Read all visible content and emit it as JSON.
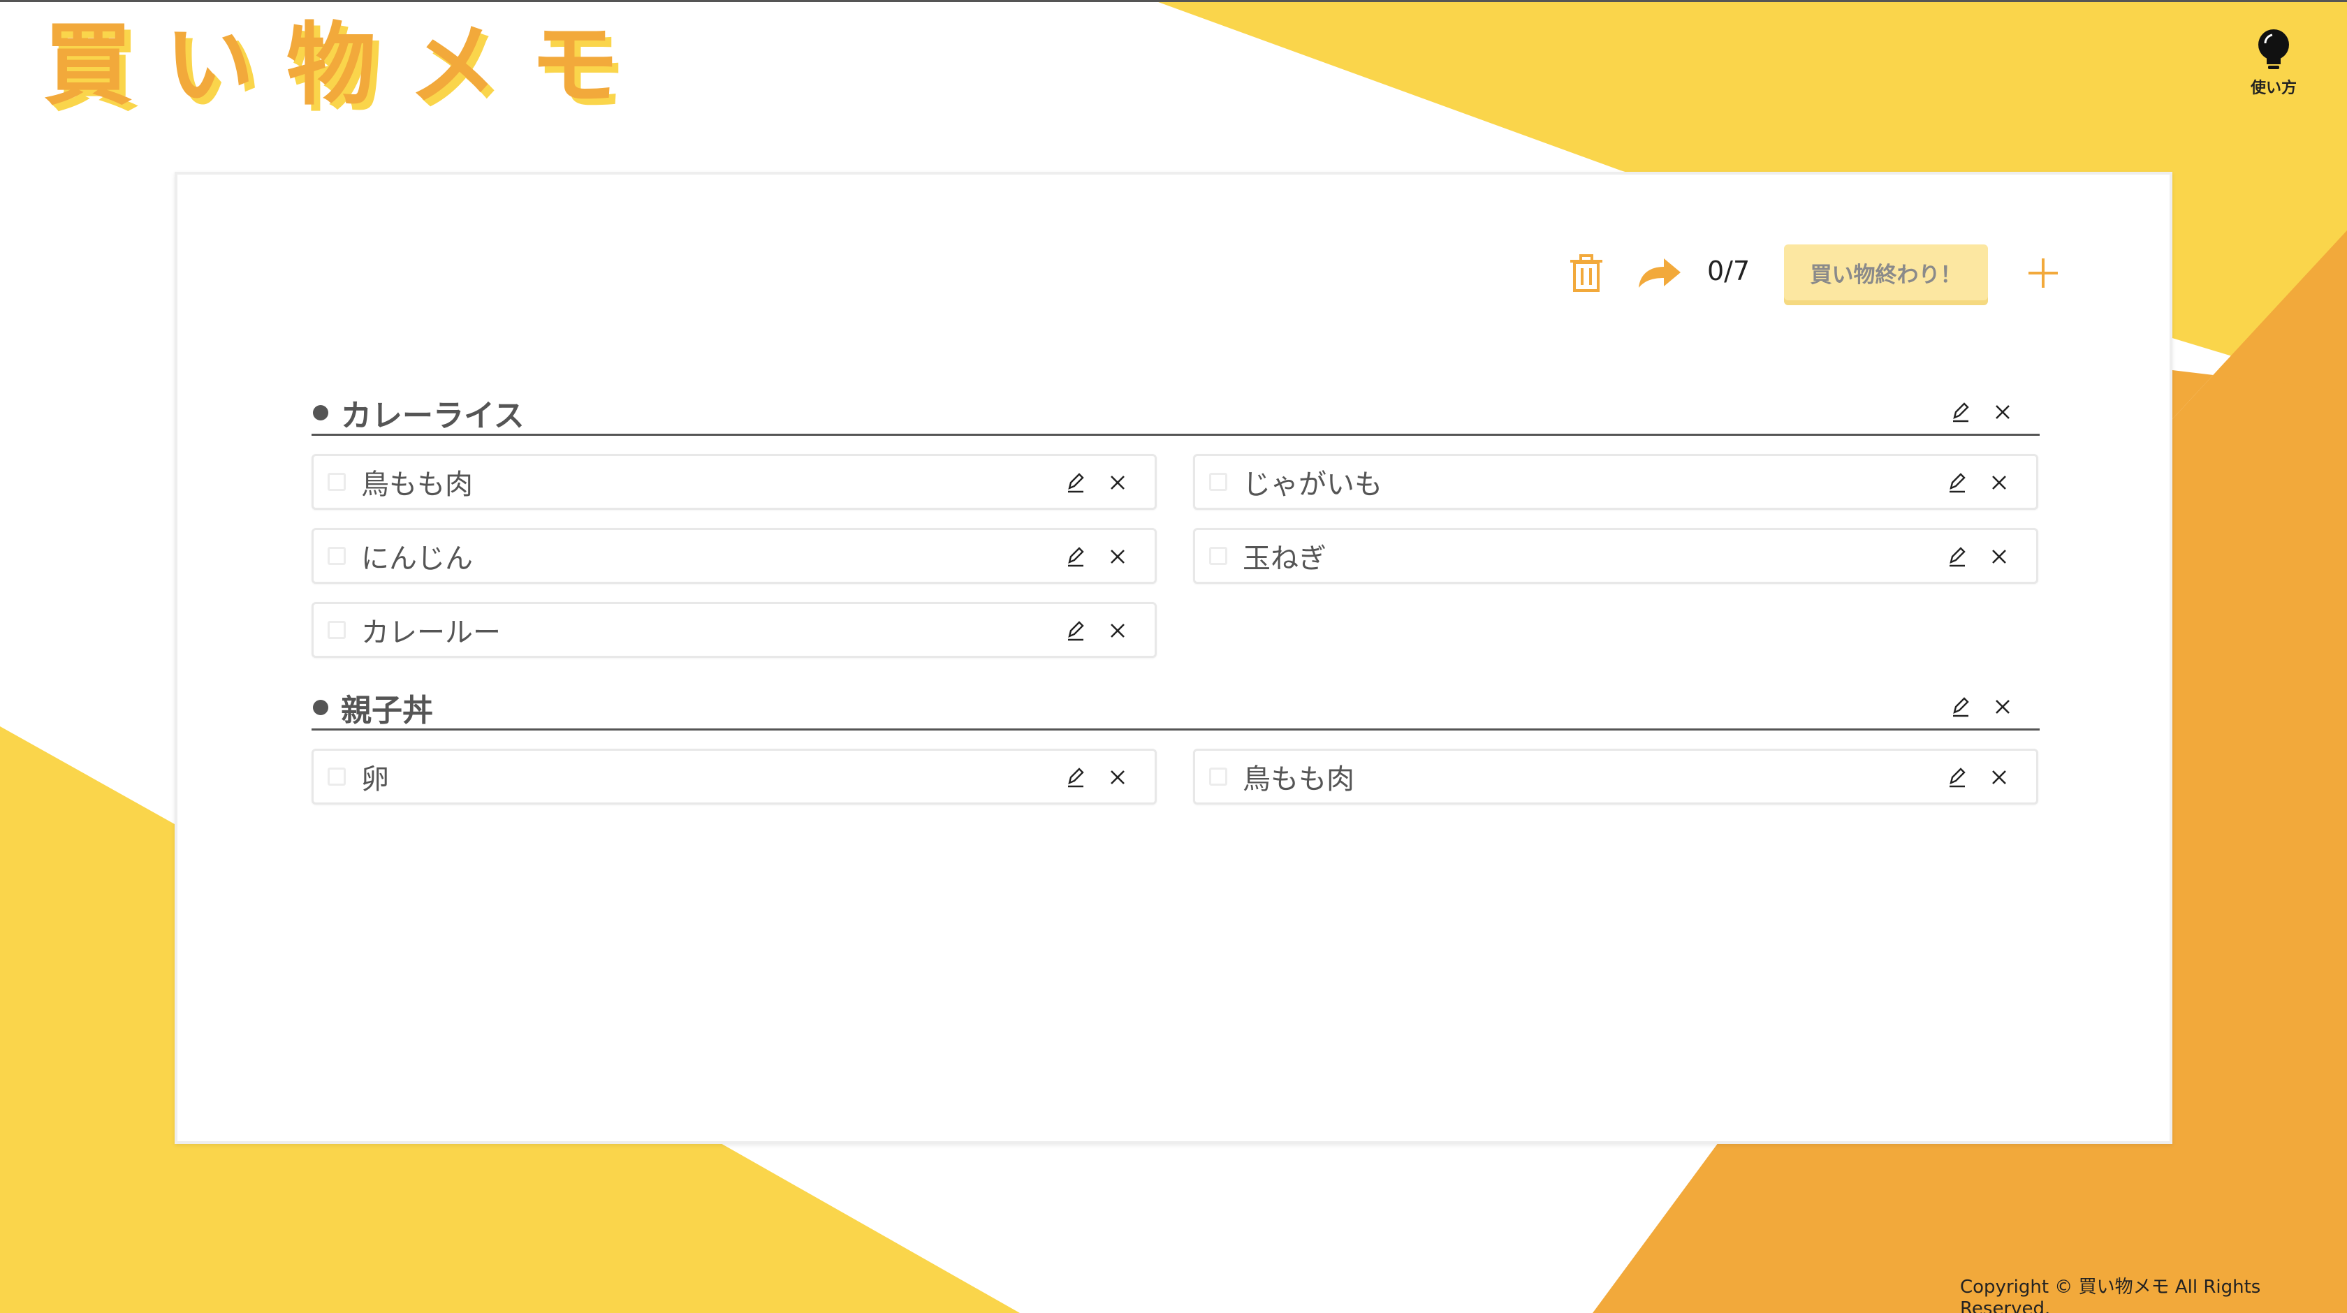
{
  "app": {
    "logo_chars": [
      "買",
      "い",
      "物",
      "メ",
      "モ"
    ],
    "help_label": "使い方"
  },
  "toolbar": {
    "counter": "0/7",
    "done_label": "買い物終わり！"
  },
  "groups": [
    {
      "title": "カレーライス",
      "items": [
        {
          "label": "鳥もも肉",
          "checked": false
        },
        {
          "label": "じゃがいも",
          "checked": false
        },
        {
          "label": "にんじん",
          "checked": false
        },
        {
          "label": "玉ねぎ",
          "checked": false
        },
        {
          "label": "カレールー",
          "checked": false
        }
      ]
    },
    {
      "title": "親子丼",
      "items": [
        {
          "label": "卵",
          "checked": false
        },
        {
          "label": "鳥もも肉",
          "checked": false
        }
      ]
    }
  ],
  "footer": {
    "copyright": "Copyright © 買い物メモ All Rights Reserved."
  },
  "colors": {
    "yellow": "#fad54b",
    "orange": "#f2a93b",
    "text": "#555555"
  },
  "icons": [
    "trash-icon",
    "share-icon",
    "plus-icon",
    "edit-icon",
    "close-icon",
    "lightbulb-icon"
  ]
}
